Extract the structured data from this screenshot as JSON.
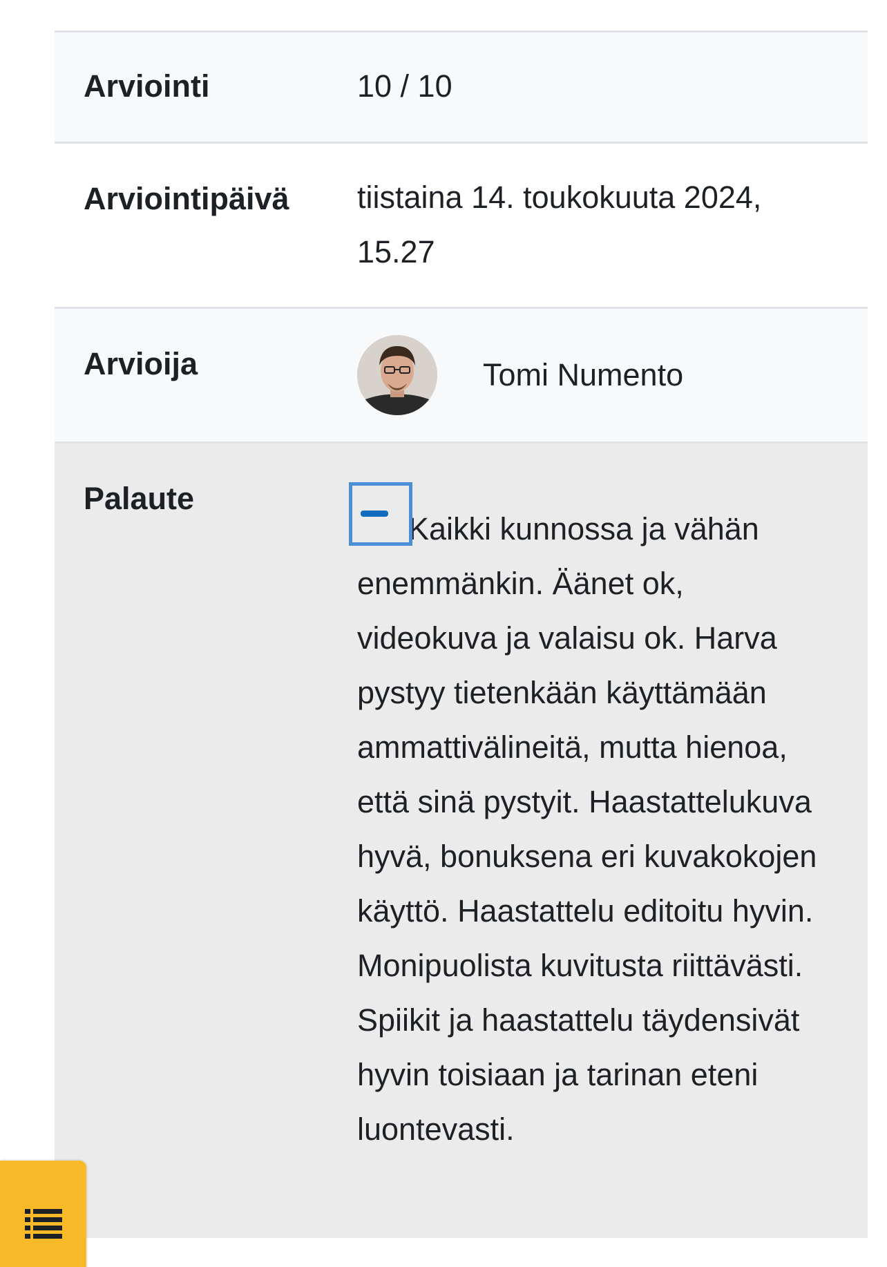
{
  "grade": {
    "label": "Arviointi",
    "value": "10 / 10"
  },
  "date": {
    "label": "Arviointipäivä",
    "value": "tiistaina 14. toukokuuta 2024, 15.27"
  },
  "grader": {
    "label": "Arvioija",
    "name": "Tomi Numento"
  },
  "feedback": {
    "label": "Palaute",
    "text": "Kaikki kunnossa ja vähän enemmänkin. Äänet ok, videokuva ja valaisu ok. Harva pystyy tietenkään käyttämään ammattivälineitä, mutta hienoa, että sinä pystyit. Haastattelukuva hyvä, bonuksena eri kuvakokojen käyttö. Haastattelu editoitu hyvin. Monipuolista kuvitusta riittävästi. Spiikit ja haastattelu täydensivät hyvin toisiaan ja tarinan eteni luontevasti."
  },
  "icons": {
    "collapse": "minus-icon",
    "drawer": "list-icon"
  },
  "colors": {
    "drawer_bg": "#f9b929",
    "collapse_focus": "#4a8fd6",
    "collapse_icon": "#0f6cbf"
  }
}
